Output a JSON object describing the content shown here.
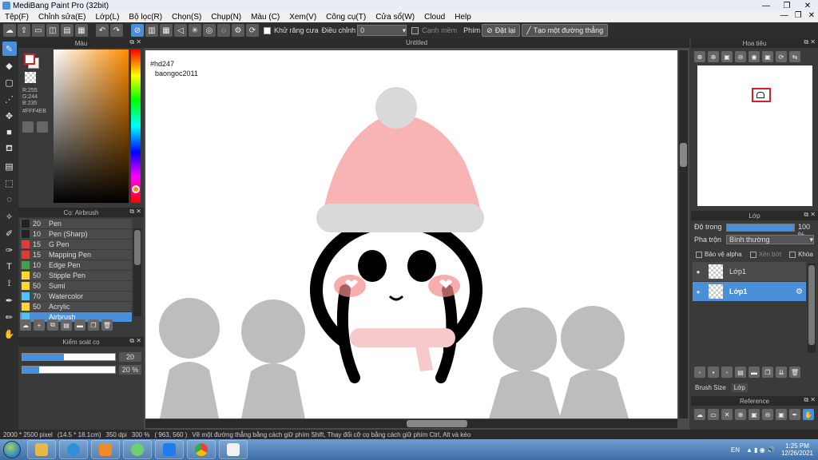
{
  "window": {
    "title": "MediBang Paint Pro (32bit)",
    "minimize_glyph": "—",
    "maximize_glyph": "❐",
    "close_glyph": "✕"
  },
  "menu": {
    "items": [
      "Tệp(F)",
      "Chỉnh sửa(E)",
      "Lớp(L)",
      "Bộ lọc(R)",
      "Chọn(S)",
      "Chụp(N)",
      "Màu (C)",
      "Xem(V)",
      "Công cụ(T)",
      "Cửa sổ(W)",
      "Cloud",
      "Help"
    ],
    "doc_controls": [
      "—",
      "❐",
      "✕"
    ]
  },
  "toolbar": {
    "antialias_label": "Khử răng cưa",
    "correction_label": "Điều chỉnh",
    "correction_value": "0",
    "edge_label": "Cạnh mềm",
    "snap_label": "Phím",
    "reset_label": "Đặt lại",
    "create_line_label": "Tạo một đường thẳng"
  },
  "color_panel": {
    "title": "Màu",
    "r": "R:255",
    "g": "G:244",
    "b": "B:235",
    "hex": "#FFF4EB",
    "fg_color": "#FFFFFF",
    "fg_border": "#D32020",
    "bg_color": "#FFF4EB"
  },
  "brush_panel": {
    "title": "Cọ: Airbrush",
    "items": [
      {
        "size": "20",
        "name": "Pen",
        "color": "#222222"
      },
      {
        "size": "10",
        "name": "Pen (Sharp)",
        "color": "#222222"
      },
      {
        "size": "15",
        "name": "G Pen",
        "color": "#e53935"
      },
      {
        "size": "15",
        "name": "Mapping Pen",
        "color": "#e53935"
      },
      {
        "size": "10",
        "name": "Edge Pen",
        "color": "#43a047"
      },
      {
        "size": "50",
        "name": "Stipple Pen",
        "color": "#fdd835"
      },
      {
        "size": "50",
        "name": "Sumi",
        "color": "#fdd835"
      },
      {
        "size": "70",
        "name": "Watercolor",
        "color": "#4fc3f7"
      },
      {
        "size": "50",
        "name": "Acrylic",
        "color": "#fdd835"
      },
      {
        "size": "",
        "name": "Airbrush",
        "color": "#4fc3f7"
      }
    ]
  },
  "brush_control": {
    "title": "Kiểm soát cọ",
    "size_value": "20",
    "size_fraction": 0.45,
    "opacity_value": "20 %",
    "opacity_fraction": 0.18
  },
  "document": {
    "tab_title": "Untitled",
    "watermark_1": "#hd247",
    "watermark_2": "baongoc2011"
  },
  "navigator": {
    "title": "Hoa tiêu"
  },
  "layer_panel": {
    "title": "Lớp",
    "opacity_label": "Độ trong",
    "opacity_value": "100 %",
    "blend_label": "Pha trộn",
    "blend_value": "Bình thường",
    "protect_alpha_label": "Bảo vệ alpha",
    "clip_label": "Xén bớt",
    "lock_label": "Khóa",
    "layers": [
      {
        "name": "Lớp1",
        "selected": false
      },
      {
        "name": "Lớp1",
        "selected": true
      }
    ],
    "tab_brush_size": "Brush Size",
    "tab_layer": "Lớp"
  },
  "reference": {
    "title": "Reference"
  },
  "status": {
    "canvas_size": "2000 * 2500 pixel",
    "physical_size": "(14.5 * 18.1cm)",
    "dpi": "350 dpi",
    "zoom": "300 %",
    "cursor": "( 963, 560 )",
    "hint": "Vẽ một đường thẳng bằng cách giữ phím Shift, Thay đổi cỡ cọ bằng cách giữ phím Ctrl, Alt và kéo"
  },
  "taskbar": {
    "language": "EN",
    "time": "1:25 PM",
    "date": "12/26/2021"
  },
  "colors": {
    "accent": "#4A8FD8",
    "hat_pink": "#F8B4B4",
    "hat_trim": "#D9D9D9",
    "scarf": "#F6CACA",
    "blush": "#F28A8A",
    "crowd_gray": "#BDBDBD"
  }
}
